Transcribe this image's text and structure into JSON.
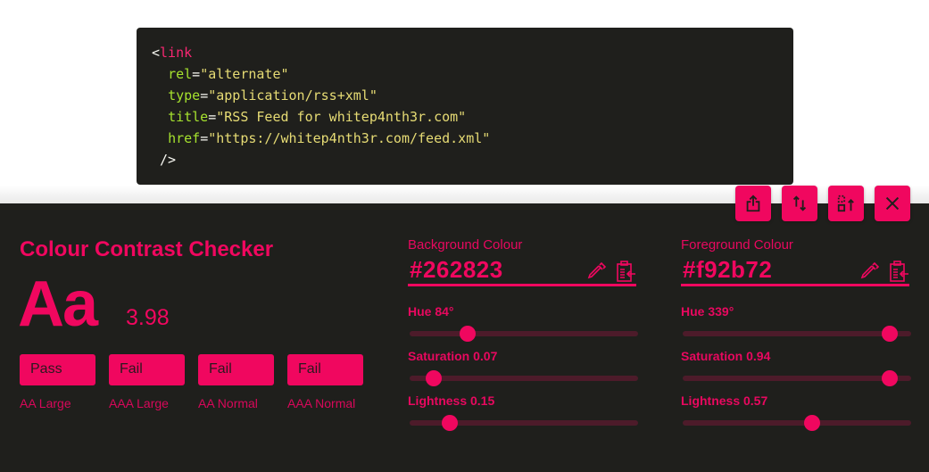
{
  "code": {
    "lines": [
      [
        {
          "t": "punct",
          "v": "<"
        },
        {
          "t": "tag",
          "v": "link"
        }
      ],
      [
        {
          "t": "punct",
          "v": "  "
        },
        {
          "t": "attr",
          "v": "rel"
        },
        {
          "t": "punct",
          "v": "="
        },
        {
          "t": "str",
          "v": "\"alternate\""
        }
      ],
      [
        {
          "t": "punct",
          "v": "  "
        },
        {
          "t": "attr",
          "v": "type"
        },
        {
          "t": "punct",
          "v": "="
        },
        {
          "t": "str",
          "v": "\"application/rss+xml\""
        }
      ],
      [
        {
          "t": "punct",
          "v": "  "
        },
        {
          "t": "attr",
          "v": "title"
        },
        {
          "t": "punct",
          "v": "="
        },
        {
          "t": "str",
          "v": "\"RSS Feed for whitep4nth3r.com\""
        }
      ],
      [
        {
          "t": "punct",
          "v": "  "
        },
        {
          "t": "attr",
          "v": "href"
        },
        {
          "t": "punct",
          "v": "="
        },
        {
          "t": "str",
          "v": "\"https://whitep4nth3r.com/feed.xml\""
        }
      ],
      [
        {
          "t": "punct",
          "v": " />"
        }
      ]
    ]
  },
  "toolbar": {
    "buttons": [
      {
        "name": "export-button",
        "icon": "share-icon"
      },
      {
        "name": "swap-colours-button",
        "icon": "swap-vertical-icon"
      },
      {
        "name": "dock-position-button",
        "icon": "move-panel-icon"
      },
      {
        "name": "close-button",
        "icon": "close-icon"
      }
    ]
  },
  "checker": {
    "title": "Colour Contrast Checker",
    "sample_text": "Aa",
    "ratio": "3.98",
    "results": [
      {
        "status": "Pass",
        "label": "AA Large"
      },
      {
        "status": "Fail",
        "label": "AAA Large"
      },
      {
        "status": "Fail",
        "label": "AA Normal"
      },
      {
        "status": "Fail",
        "label": "AAA Normal"
      }
    ]
  },
  "background": {
    "label": "Background Colour",
    "hex": "#262823",
    "hue_label": "Hue 84°",
    "hue": 84,
    "saturation_label": "Saturation 0.07",
    "saturation": 0.07,
    "lightness_label": "Lightness 0.15",
    "lightness": 0.15
  },
  "foreground": {
    "label": "Foreground Colour",
    "hex": "#f92b72",
    "hue_label": "Hue 339°",
    "hue": 339,
    "saturation_label": "Saturation 0.94",
    "saturation": 0.94,
    "lightness_label": "Lightness 0.57",
    "lightness": 0.57
  },
  "colors": {
    "accent": "#f0075f",
    "panel_bg": "#1f1f1c",
    "track": "#4d1b2a"
  }
}
